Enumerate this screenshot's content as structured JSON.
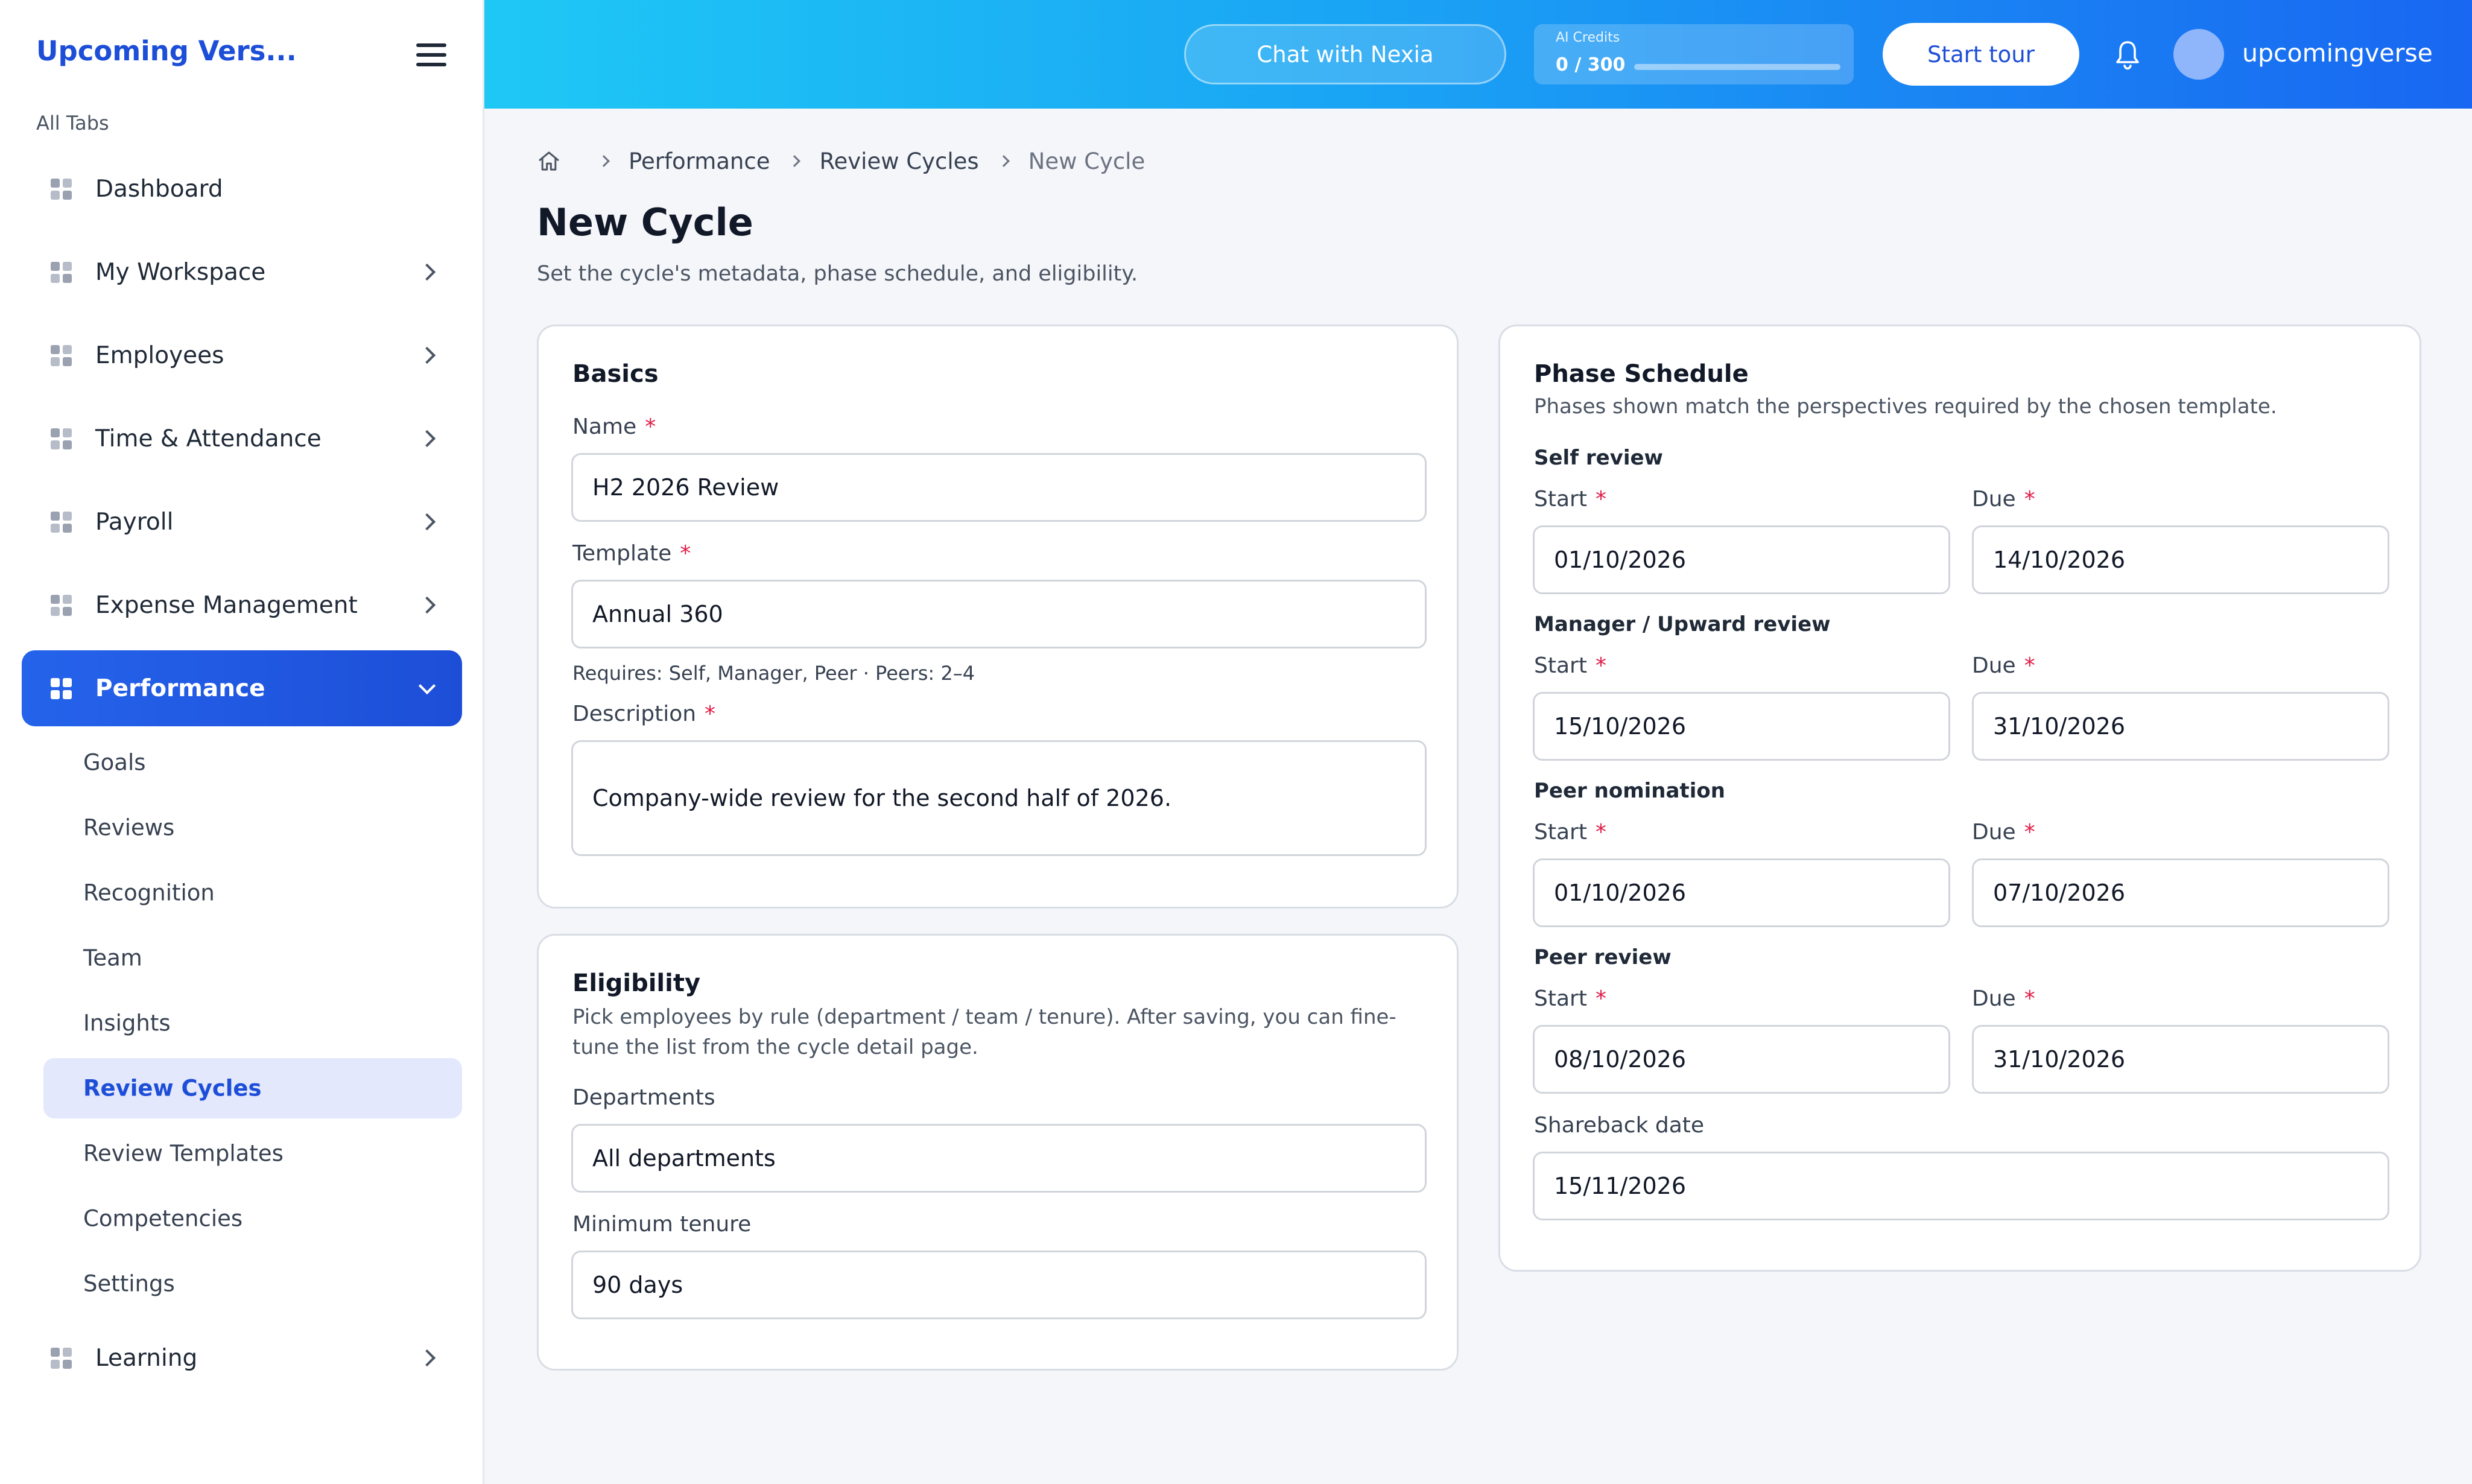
{
  "sidebar": {
    "brand": "Upcoming Vers...",
    "all_tabs": "All Tabs",
    "items": [
      {
        "label": "Dashboard"
      },
      {
        "label": "My Workspace"
      },
      {
        "label": "Employees"
      },
      {
        "label": "Time & Attendance"
      },
      {
        "label": "Payroll"
      },
      {
        "label": "Expense Management"
      },
      {
        "label": "Performance"
      },
      {
        "label": "Learning"
      }
    ],
    "sub_items": [
      {
        "label": "Goals"
      },
      {
        "label": "Reviews"
      },
      {
        "label": "Recognition"
      },
      {
        "label": "Team"
      },
      {
        "label": "Insights"
      },
      {
        "label": "Review Cycles"
      },
      {
        "label": "Review Templates"
      },
      {
        "label": "Competencies"
      },
      {
        "label": "Settings"
      }
    ]
  },
  "topbar": {
    "chat_label": "Chat with Nexia",
    "credits_label": "AI Credits",
    "credits_value": "0 / 300",
    "credits_fill_percent": 0,
    "tour_label": "Start tour",
    "username": "upcomingverse"
  },
  "breadcrumb": [
    "Performance",
    "Review Cycles",
    "New Cycle"
  ],
  "page": {
    "title": "New Cycle",
    "subtitle": "Set the cycle's metadata, phase schedule, and eligibility."
  },
  "basics": {
    "title": "Basics",
    "name_label": "Name",
    "name_value": "H2 2026 Review",
    "template_label": "Template",
    "template_value": "Annual 360",
    "template_hint": "Requires: Self, Manager, Peer · Peers: 2–4",
    "description_label": "Description",
    "description_value": "Company-wide review for the second half of 2026."
  },
  "eligibility": {
    "title": "Eligibility",
    "description": "Pick employees by rule (department / team / tenure). After saving, you can fine-tune the list from the cycle detail page.",
    "departments_label": "Departments",
    "departments_value": "All departments",
    "tenure_label": "Minimum tenure",
    "tenure_value": "90 days"
  },
  "schedule": {
    "title": "Phase Schedule",
    "description": "Phases shown match the perspectives required by the chosen template.",
    "start_label": "Start",
    "due_label": "Due",
    "phases": [
      {
        "name": "Self review",
        "start": "01/10/2026",
        "due": "14/10/2026"
      },
      {
        "name": "Manager / Upward review",
        "start": "15/10/2026",
        "due": "31/10/2026"
      },
      {
        "name": "Peer nomination",
        "start": "01/10/2026",
        "due": "07/10/2026"
      },
      {
        "name": "Peer review",
        "start": "08/10/2026",
        "due": "31/10/2026"
      }
    ],
    "shareback_label": "Shareback date",
    "shareback_value": "15/11/2026"
  },
  "colors": {
    "accent": "#1d4ed8",
    "topbar_start": "#1ec8f5",
    "topbar_end": "#1967f2",
    "required": "#e11d48"
  }
}
